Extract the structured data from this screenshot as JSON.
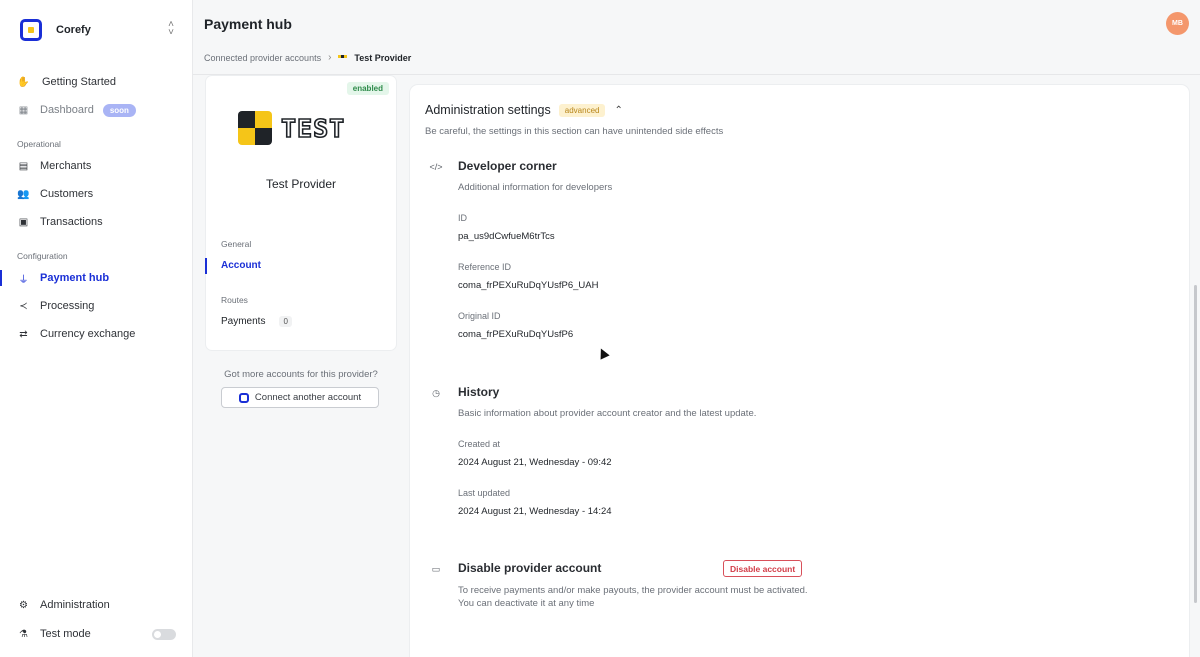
{
  "org": {
    "name": "Corefy",
    "switch_icon": "chevron-up-down-icon"
  },
  "sidebar": {
    "top_items": [
      {
        "label": "Getting Started",
        "icon": "waving-hand-icon"
      },
      {
        "label": "Dashboard",
        "icon": "dashboard-icon",
        "badge": "soon"
      }
    ],
    "operational_label": "Operational",
    "operational": [
      {
        "label": "Merchants",
        "icon": "store-icon"
      },
      {
        "label": "Customers",
        "icon": "users-icon"
      },
      {
        "label": "Transactions",
        "icon": "transactions-icon"
      }
    ],
    "configuration_label": "Configuration",
    "configuration": [
      {
        "label": "Payment hub",
        "icon": "plug-icon"
      },
      {
        "label": "Processing",
        "icon": "share-icon"
      },
      {
        "label": "Currency exchange",
        "icon": "exchange-icon"
      }
    ],
    "bottom": [
      {
        "label": "Administration",
        "icon": "gear-icon"
      },
      {
        "label": "Test mode",
        "icon": "flask-icon"
      }
    ]
  },
  "header": {
    "title": "Payment hub",
    "avatar_initials": "MB",
    "breadcrumb": {
      "parent": "Connected provider accounts",
      "current": "Test Provider"
    }
  },
  "provider": {
    "status": "enabled",
    "logo_text": "TEST",
    "name": "Test Provider",
    "general_label": "General",
    "account_label": "Account",
    "routes_label": "Routes",
    "payments_label": "Payments",
    "payments_count": "0",
    "more_text": "Got more accounts for this provider?",
    "connect_label": "Connect another account"
  },
  "admin": {
    "title": "Administration settings",
    "badge": "advanced",
    "subtitle": "Be careful, the settings in this section can have unintended side effects",
    "developer": {
      "title": "Developer corner",
      "subtitle": "Additional information for developers",
      "id_label": "ID",
      "id_value": "pa_us9dCwfueM6trTcs",
      "ref_label": "Reference ID",
      "ref_value": "coma_frPEXuRuDqYUsfP6_UAH",
      "orig_label": "Original ID",
      "orig_value": "coma_frPEXuRuDqYUsfP6"
    },
    "history": {
      "title": "History",
      "subtitle": "Basic information about provider account creator and the latest update.",
      "created_label": "Created at",
      "created_value": "2024 August 21, Wednesday - 09:42",
      "updated_label": "Last updated",
      "updated_value": "2024 August 21, Wednesday - 14:24"
    },
    "disable": {
      "title": "Disable provider account",
      "button": "Disable account",
      "description": "To receive payments and/or make payouts, the provider account must be activated. You can deactivate it at any time"
    }
  },
  "colors": {
    "accent": "#1a2fd6",
    "logo_yellow": "#f5c518",
    "danger": "#d23c47",
    "success": "#2e8b4a",
    "avatar": "#f4976c"
  }
}
